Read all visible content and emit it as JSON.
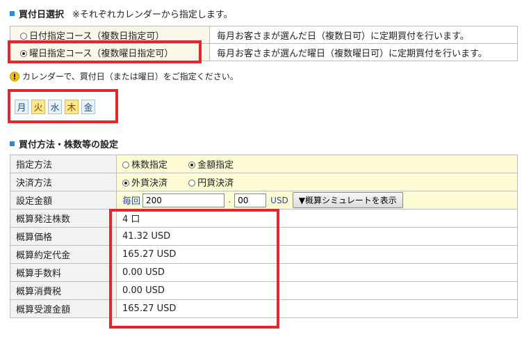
{
  "section1": {
    "title": "買付日選択",
    "note": "※それぞれカレンダーから指定します。",
    "courses": [
      {
        "label": "日付指定コース（複数日指定可）",
        "description": "毎月お客さまが選んだ日（複数日可）に定期買付を行います。",
        "selected": false
      },
      {
        "label": "曜日指定コース（複数曜日指定可）",
        "description": "毎月お客さまが選んだ曜日（複数曜日可）に定期買付を行います。",
        "selected": true
      }
    ],
    "notice": "カレンダーで、買付日（または曜日）をご指定ください。",
    "days": [
      {
        "label": "月",
        "selected": false
      },
      {
        "label": "火",
        "selected": true
      },
      {
        "label": "水",
        "selected": false
      },
      {
        "label": "木",
        "selected": true
      },
      {
        "label": "金",
        "selected": false
      }
    ]
  },
  "section2": {
    "title": "買付方法・株数等の設定",
    "method": {
      "label": "指定方法",
      "options": [
        "株数指定",
        "金額指定"
      ],
      "selected": "金額指定"
    },
    "settlement": {
      "label": "決済方法",
      "options": [
        "外貨決済",
        "円貨決済"
      ],
      "selected": "外貨決済"
    },
    "amount": {
      "label": "設定金額",
      "prefix": "毎回",
      "integer_value": "200",
      "decimal_sep": ".",
      "decimal_value": "00",
      "currency": "USD",
      "sim_button": "▼概算シミュレートを表示"
    },
    "results": [
      {
        "label": "概算発注株数",
        "value": "4 口"
      },
      {
        "label": "概算価格",
        "value": "41.32 USD"
      },
      {
        "label": "概算約定代金",
        "value": "165.27 USD"
      },
      {
        "label": "概算手数料",
        "value": "0.00 USD"
      },
      {
        "label": "概算消費税",
        "value": "0.00 USD"
      },
      {
        "label": "概算受渡金額",
        "value": "165.27 USD"
      }
    ]
  },
  "colors": {
    "accent_red": "#e3262e",
    "section_blue": "#2a8ad4",
    "option_bg": "#fdfbd4",
    "label_bg": "#f2f2f2"
  }
}
